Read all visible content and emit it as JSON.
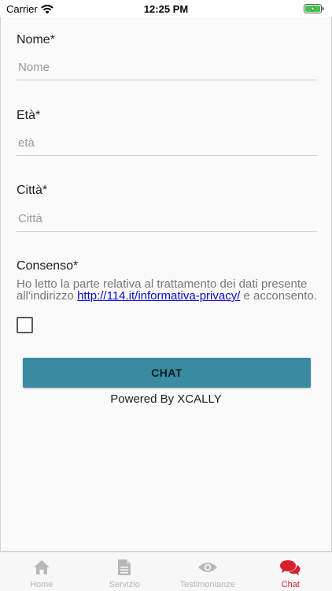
{
  "status": {
    "carrier": "Carrier",
    "time": "12:25 PM"
  },
  "form": {
    "nome": {
      "label": "Nome*",
      "placeholder": "Nome",
      "value": ""
    },
    "eta": {
      "label": "Età*",
      "placeholder": "età",
      "value": ""
    },
    "citta": {
      "label": "Città*",
      "placeholder": "Città",
      "value": ""
    },
    "consenso": {
      "label": "Consenso*",
      "text_before": "Ho letto la parte relativa al trattamento dei dati presente all'indirizzo ",
      "link": "http://114.it/informativa-privacy/",
      "text_after": " e acconsento.",
      "checked": false
    },
    "submit_label": "CHAT",
    "powered_by": "Powered By XCALLY"
  },
  "tabs": [
    {
      "label": "Home",
      "icon": "home-icon",
      "active": false
    },
    {
      "label": "Servizio",
      "icon": "document-icon",
      "active": false
    },
    {
      "label": "Testimonianze",
      "icon": "eye-icon",
      "active": false
    },
    {
      "label": "Chat",
      "icon": "chat-bubbles-icon",
      "active": true
    }
  ],
  "colors": {
    "button": "#3a8aa0",
    "active_tab": "#d4202e",
    "inactive_tab": "#b5b5b5",
    "link": "#0a0ad0"
  }
}
